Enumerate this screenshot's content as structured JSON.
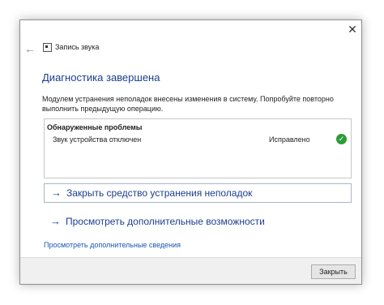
{
  "window": {
    "close_glyph": "✕",
    "back_glyph": "←",
    "title": "Запись звука"
  },
  "main": {
    "heading": "Диагностика завершена",
    "description": "Модулем устранения неполадок внесены изменения в систему. Попробуйте повторно выполнить предыдущую операцию.",
    "problems": {
      "header": "Обнаруженные проблемы",
      "items": [
        {
          "name": "Звук устройства отключен",
          "status": "Исправлено",
          "status_icon": "check-icon"
        }
      ]
    },
    "links": [
      {
        "label": "Закрыть средство устранения неполадок",
        "arrow": "→"
      },
      {
        "label": "Просмотреть дополнительные возможности",
        "arrow": "→"
      }
    ],
    "details_link": "Просмотреть дополнительные сведения"
  },
  "footer": {
    "close_label": "Закрыть"
  },
  "colors": {
    "heading": "#1a3e8f",
    "link": "#1a55b8",
    "success": "#2f9a3a",
    "footer_bg": "#f0f0f0"
  }
}
